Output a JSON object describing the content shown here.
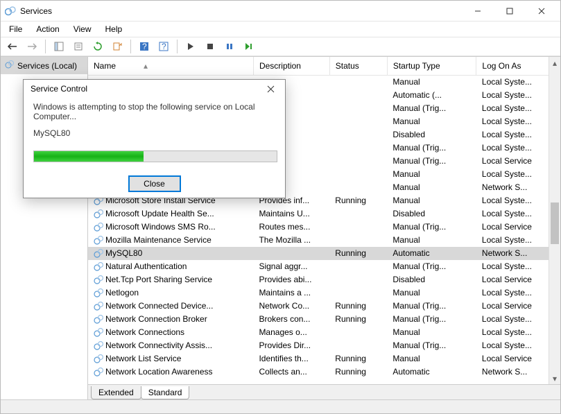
{
  "window": {
    "title": "Services"
  },
  "menu": {
    "file": "File",
    "action": "Action",
    "view": "View",
    "help": "Help"
  },
  "leftpane": {
    "node": "Services (Local)"
  },
  "columns": {
    "name": "Name",
    "description": "Description",
    "status": "Status",
    "startup": "Startup Type",
    "logon": "Log On As"
  },
  "tabs": {
    "extended": "Extended",
    "standard": "Standard"
  },
  "dialog": {
    "title": "Service Control",
    "message": "Windows is attempting to stop the following service on Local Computer...",
    "service": "MySQL80",
    "close": "Close"
  },
  "services": [
    {
      "name": "",
      "description": "",
      "status": "",
      "startup": "Manual",
      "logon": "Local Syste..."
    },
    {
      "name": "",
      "description": "",
      "status": "",
      "startup": "Automatic (...",
      "logon": "Local Syste..."
    },
    {
      "name": "",
      "description": "",
      "status": "",
      "startup": "Manual (Trig...",
      "logon": "Local Syste..."
    },
    {
      "name": "",
      "description": "",
      "status": "",
      "startup": "Manual",
      "logon": "Local Syste..."
    },
    {
      "name": "",
      "description": "",
      "status": "",
      "startup": "Disabled",
      "logon": "Local Syste..."
    },
    {
      "name": "",
      "description": "",
      "status": "",
      "startup": "Manual (Trig...",
      "logon": "Local Syste..."
    },
    {
      "name": "",
      "description": "",
      "status": "",
      "startup": "Manual (Trig...",
      "logon": "Local Service"
    },
    {
      "name": "",
      "description": "",
      "status": "",
      "startup": "Manual",
      "logon": "Local Syste..."
    },
    {
      "name": "",
      "description": "",
      "status": "",
      "startup": "Manual",
      "logon": "Network S..."
    },
    {
      "name": "Microsoft Store Install Service",
      "description": "Provides inf...",
      "status": "Running",
      "startup": "Manual",
      "logon": "Local Syste..."
    },
    {
      "name": "Microsoft Update Health Se...",
      "description": "Maintains U...",
      "status": "",
      "startup": "Disabled",
      "logon": "Local Syste..."
    },
    {
      "name": "Microsoft Windows SMS Ro...",
      "description": "Routes mes...",
      "status": "",
      "startup": "Manual (Trig...",
      "logon": "Local Service"
    },
    {
      "name": "Mozilla Maintenance Service",
      "description": "The Mozilla ...",
      "status": "",
      "startup": "Manual",
      "logon": "Local Syste..."
    },
    {
      "name": "MySQL80",
      "description": "",
      "status": "Running",
      "startup": "Automatic",
      "logon": "Network S...",
      "selected": true
    },
    {
      "name": "Natural Authentication",
      "description": "Signal aggr...",
      "status": "",
      "startup": "Manual (Trig...",
      "logon": "Local Syste..."
    },
    {
      "name": "Net.Tcp Port Sharing Service",
      "description": "Provides abi...",
      "status": "",
      "startup": "Disabled",
      "logon": "Local Service"
    },
    {
      "name": "Netlogon",
      "description": "Maintains a ...",
      "status": "",
      "startup": "Manual",
      "logon": "Local Syste..."
    },
    {
      "name": "Network Connected Device...",
      "description": "Network Co...",
      "status": "Running",
      "startup": "Manual (Trig...",
      "logon": "Local Service"
    },
    {
      "name": "Network Connection Broker",
      "description": "Brokers con...",
      "status": "Running",
      "startup": "Manual (Trig...",
      "logon": "Local Syste..."
    },
    {
      "name": "Network Connections",
      "description": "Manages o...",
      "status": "",
      "startup": "Manual",
      "logon": "Local Syste..."
    },
    {
      "name": "Network Connectivity Assis...",
      "description": "Provides Dir...",
      "status": "",
      "startup": "Manual (Trig...",
      "logon": "Local Syste..."
    },
    {
      "name": "Network List Service",
      "description": "Identifies th...",
      "status": "Running",
      "startup": "Manual",
      "logon": "Local Service"
    },
    {
      "name": "Network Location Awareness",
      "description": "Collects an...",
      "status": "Running",
      "startup": "Automatic",
      "logon": "Network S..."
    }
  ]
}
